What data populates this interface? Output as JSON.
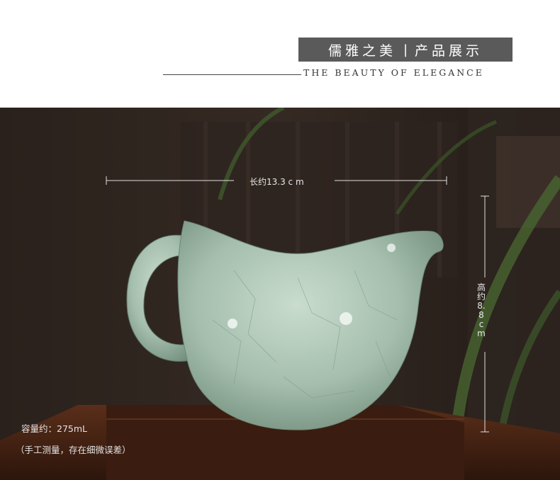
{
  "header": {
    "title_left": "儒雅之美",
    "title_right": "产品展示",
    "subtitle": "THE BEAUTY OF ELEGANCE"
  },
  "product": {
    "length_label": "长约13.3 c m",
    "height_label": "高约8.8 c m",
    "capacity_label": "容量约：275mL",
    "note_label": "（手工测量，存在细微误差）"
  },
  "colors": {
    "title_band": "#5a5a5a",
    "glaze": "#a9c2b2",
    "background_dark": "#1d1714",
    "wood": "#4a2616"
  }
}
